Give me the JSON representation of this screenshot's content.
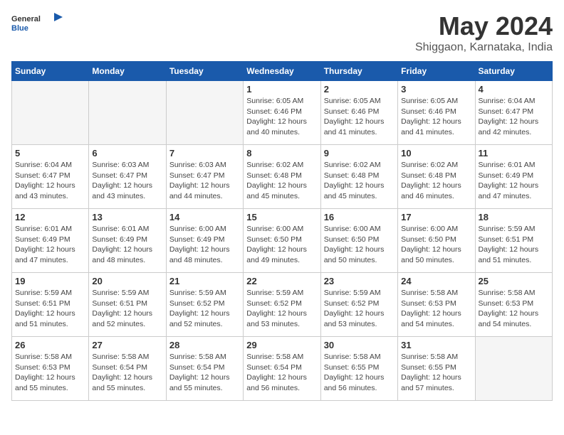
{
  "header": {
    "logo_general": "General",
    "logo_blue": "Blue",
    "title": "May 2024",
    "location": "Shiggaon, Karnataka, India"
  },
  "weekdays": [
    "Sunday",
    "Monday",
    "Tuesday",
    "Wednesday",
    "Thursday",
    "Friday",
    "Saturday"
  ],
  "weeks": [
    [
      {
        "day": "",
        "info": ""
      },
      {
        "day": "",
        "info": ""
      },
      {
        "day": "",
        "info": ""
      },
      {
        "day": "1",
        "info": "Sunrise: 6:05 AM\nSunset: 6:46 PM\nDaylight: 12 hours\nand 40 minutes."
      },
      {
        "day": "2",
        "info": "Sunrise: 6:05 AM\nSunset: 6:46 PM\nDaylight: 12 hours\nand 41 minutes."
      },
      {
        "day": "3",
        "info": "Sunrise: 6:05 AM\nSunset: 6:46 PM\nDaylight: 12 hours\nand 41 minutes."
      },
      {
        "day": "4",
        "info": "Sunrise: 6:04 AM\nSunset: 6:47 PM\nDaylight: 12 hours\nand 42 minutes."
      }
    ],
    [
      {
        "day": "5",
        "info": "Sunrise: 6:04 AM\nSunset: 6:47 PM\nDaylight: 12 hours\nand 43 minutes."
      },
      {
        "day": "6",
        "info": "Sunrise: 6:03 AM\nSunset: 6:47 PM\nDaylight: 12 hours\nand 43 minutes."
      },
      {
        "day": "7",
        "info": "Sunrise: 6:03 AM\nSunset: 6:47 PM\nDaylight: 12 hours\nand 44 minutes."
      },
      {
        "day": "8",
        "info": "Sunrise: 6:02 AM\nSunset: 6:48 PM\nDaylight: 12 hours\nand 45 minutes."
      },
      {
        "day": "9",
        "info": "Sunrise: 6:02 AM\nSunset: 6:48 PM\nDaylight: 12 hours\nand 45 minutes."
      },
      {
        "day": "10",
        "info": "Sunrise: 6:02 AM\nSunset: 6:48 PM\nDaylight: 12 hours\nand 46 minutes."
      },
      {
        "day": "11",
        "info": "Sunrise: 6:01 AM\nSunset: 6:49 PM\nDaylight: 12 hours\nand 47 minutes."
      }
    ],
    [
      {
        "day": "12",
        "info": "Sunrise: 6:01 AM\nSunset: 6:49 PM\nDaylight: 12 hours\nand 47 minutes."
      },
      {
        "day": "13",
        "info": "Sunrise: 6:01 AM\nSunset: 6:49 PM\nDaylight: 12 hours\nand 48 minutes."
      },
      {
        "day": "14",
        "info": "Sunrise: 6:00 AM\nSunset: 6:49 PM\nDaylight: 12 hours\nand 48 minutes."
      },
      {
        "day": "15",
        "info": "Sunrise: 6:00 AM\nSunset: 6:50 PM\nDaylight: 12 hours\nand 49 minutes."
      },
      {
        "day": "16",
        "info": "Sunrise: 6:00 AM\nSunset: 6:50 PM\nDaylight: 12 hours\nand 50 minutes."
      },
      {
        "day": "17",
        "info": "Sunrise: 6:00 AM\nSunset: 6:50 PM\nDaylight: 12 hours\nand 50 minutes."
      },
      {
        "day": "18",
        "info": "Sunrise: 5:59 AM\nSunset: 6:51 PM\nDaylight: 12 hours\nand 51 minutes."
      }
    ],
    [
      {
        "day": "19",
        "info": "Sunrise: 5:59 AM\nSunset: 6:51 PM\nDaylight: 12 hours\nand 51 minutes."
      },
      {
        "day": "20",
        "info": "Sunrise: 5:59 AM\nSunset: 6:51 PM\nDaylight: 12 hours\nand 52 minutes."
      },
      {
        "day": "21",
        "info": "Sunrise: 5:59 AM\nSunset: 6:52 PM\nDaylight: 12 hours\nand 52 minutes."
      },
      {
        "day": "22",
        "info": "Sunrise: 5:59 AM\nSunset: 6:52 PM\nDaylight: 12 hours\nand 53 minutes."
      },
      {
        "day": "23",
        "info": "Sunrise: 5:59 AM\nSunset: 6:52 PM\nDaylight: 12 hours\nand 53 minutes."
      },
      {
        "day": "24",
        "info": "Sunrise: 5:58 AM\nSunset: 6:53 PM\nDaylight: 12 hours\nand 54 minutes."
      },
      {
        "day": "25",
        "info": "Sunrise: 5:58 AM\nSunset: 6:53 PM\nDaylight: 12 hours\nand 54 minutes."
      }
    ],
    [
      {
        "day": "26",
        "info": "Sunrise: 5:58 AM\nSunset: 6:53 PM\nDaylight: 12 hours\nand 55 minutes."
      },
      {
        "day": "27",
        "info": "Sunrise: 5:58 AM\nSunset: 6:54 PM\nDaylight: 12 hours\nand 55 minutes."
      },
      {
        "day": "28",
        "info": "Sunrise: 5:58 AM\nSunset: 6:54 PM\nDaylight: 12 hours\nand 55 minutes."
      },
      {
        "day": "29",
        "info": "Sunrise: 5:58 AM\nSunset: 6:54 PM\nDaylight: 12 hours\nand 56 minutes."
      },
      {
        "day": "30",
        "info": "Sunrise: 5:58 AM\nSunset: 6:55 PM\nDaylight: 12 hours\nand 56 minutes."
      },
      {
        "day": "31",
        "info": "Sunrise: 5:58 AM\nSunset: 6:55 PM\nDaylight: 12 hours\nand 57 minutes."
      },
      {
        "day": "",
        "info": ""
      }
    ]
  ]
}
